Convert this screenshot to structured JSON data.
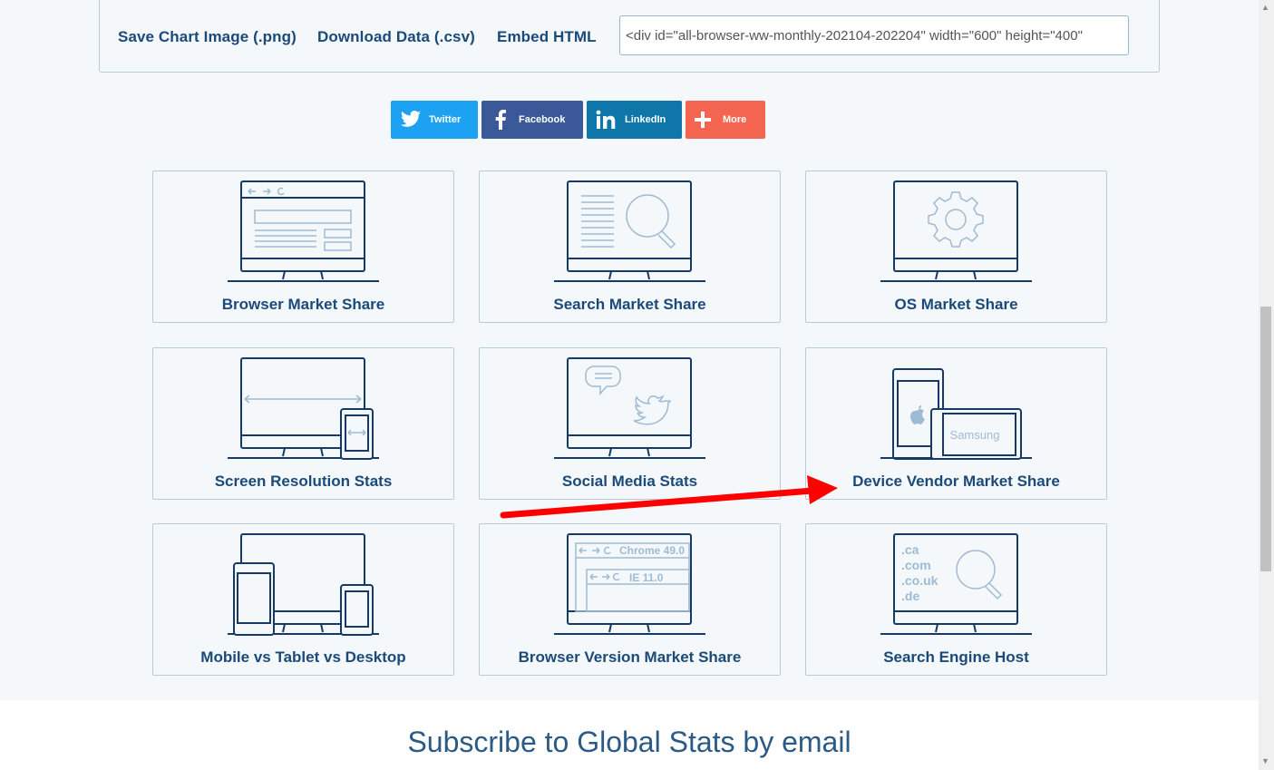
{
  "export": {
    "save_png": "Save Chart Image (.png)",
    "download_csv": "Download Data (.csv)",
    "embed_html": "Embed HTML",
    "embed_value": "<div id=\"all-browser-ww-monthly-202104-202204\" width=\"600\" height=\"400\""
  },
  "share": {
    "twitter": {
      "label": "Twitter",
      "color": "#1da1f2",
      "icon": "twitter-icon"
    },
    "facebook": {
      "label": "Facebook",
      "color": "#3b5998",
      "icon": "facebook-icon"
    },
    "linkedin": {
      "label": "LinkedIn",
      "color": "#0e76a8",
      "icon": "linkedin-icon"
    },
    "more": {
      "label": "More",
      "color": "#f46551",
      "icon": "plus-icon"
    }
  },
  "cards": [
    {
      "title": "Browser Market Share",
      "icon": "browser-monitor-icon"
    },
    {
      "title": "Search Market Share",
      "icon": "search-monitor-icon"
    },
    {
      "title": "OS Market Share",
      "icon": "gear-monitor-icon"
    },
    {
      "title": "Screen Resolution Stats",
      "icon": "resolution-monitor-icon"
    },
    {
      "title": "Social Media Stats",
      "icon": "social-monitor-icon"
    },
    {
      "title": "Device Vendor Market Share",
      "icon": "device-vendor-icon",
      "illustration_text": "Samsung"
    },
    {
      "title": "Mobile vs Tablet vs Desktop",
      "icon": "multi-device-icon"
    },
    {
      "title": "Browser Version Market Share",
      "icon": "browser-version-icon",
      "illustration_text": [
        "Chrome 49.0",
        "IE 11.0"
      ]
    },
    {
      "title": "Search Engine Host",
      "icon": "search-host-icon",
      "illustration_text": [
        ".ca",
        ".com",
        ".co.uk",
        ".de"
      ]
    }
  ],
  "subscribe": {
    "title": "Subscribe to Global Stats by email"
  },
  "colors": {
    "brand": "#1b4a7a",
    "illustration_stroke": "#163a63",
    "illustration_light": "#9fbad3",
    "annotation": "#ff0000"
  }
}
